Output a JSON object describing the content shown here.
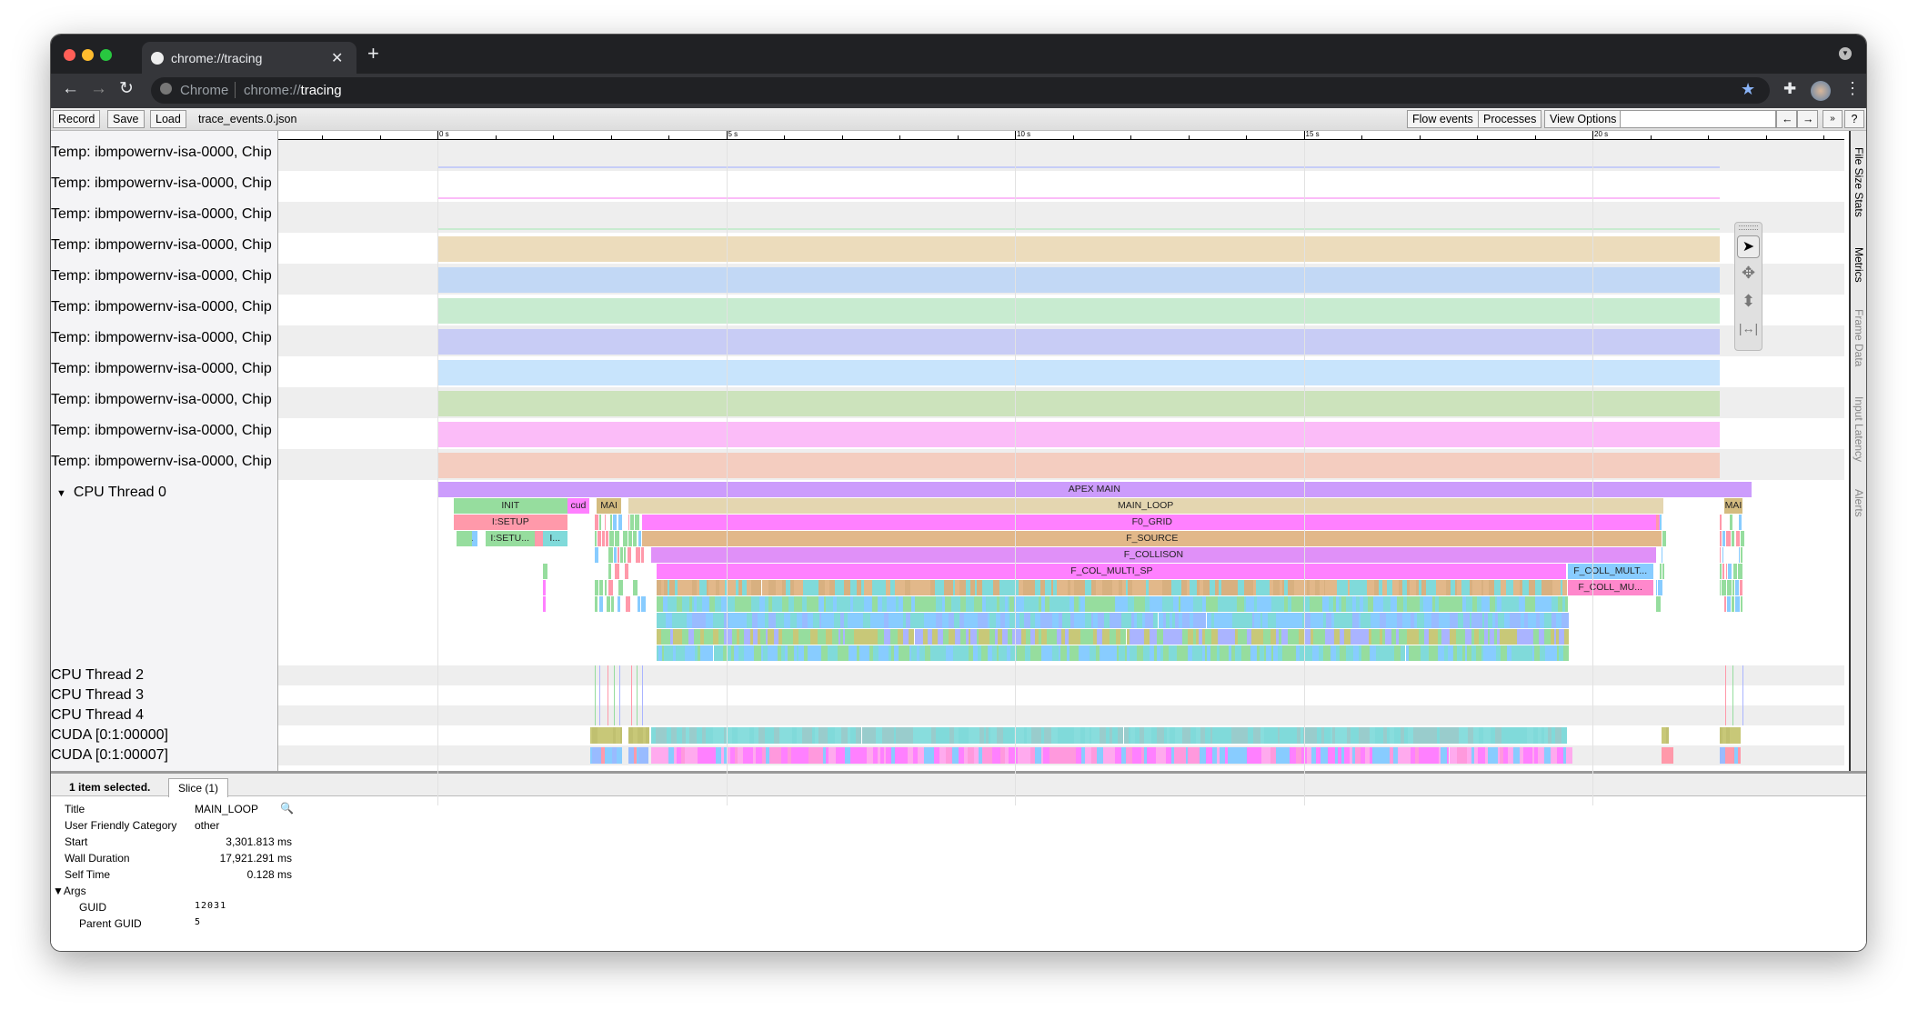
{
  "browser": {
    "tab_title": "chrome://tracing",
    "omnibox_origin": "Chrome",
    "omnibox_url_prefix": "chrome://",
    "omnibox_url_host": "tracing"
  },
  "toolbar": {
    "record": "Record",
    "save": "Save",
    "load": "Load",
    "filename": "trace_events.0.json",
    "flow_events": "Flow events",
    "processes": "Processes",
    "view_options": "View Options",
    "search_placeholder": "",
    "prev": "←",
    "next": "→",
    "collapse": "»",
    "help": "?"
  },
  "ruler": {
    "ticks": [
      {
        "t": 0,
        "label": "0 s"
      },
      {
        "t": 5,
        "label": "5 s"
      },
      {
        "t": 10,
        "label": "10 s"
      },
      {
        "t": 15,
        "label": "15 s"
      },
      {
        "t": 20,
        "label": "20 s"
      }
    ]
  },
  "temp_tracks": [
    {
      "label": "Temp: ibmpowernv-isa-0000, Chip",
      "color": "#c6cdf7",
      "style": "line"
    },
    {
      "label": "Temp: ibmpowernv-isa-0000, Chip",
      "color": "#fbbcf8",
      "style": "line"
    },
    {
      "label": "Temp: ibmpowernv-isa-0000, Chip",
      "color": "#c8ebd0",
      "style": "line"
    },
    {
      "label": "Temp: ibmpowernv-isa-0000, Chip",
      "color": "#ecdcbc",
      "style": "fill"
    },
    {
      "label": "Temp: ibmpowernv-isa-0000, Chip",
      "color": "#c2d8f5",
      "style": "fill"
    },
    {
      "label": "Temp: ibmpowernv-isa-0000, Chip",
      "color": "#c8ebd0",
      "style": "fill"
    },
    {
      "label": "Temp: ibmpowernv-isa-0000, Chip",
      "color": "#c8ccf5",
      "style": "fill"
    },
    {
      "label": "Temp: ibmpowernv-isa-0000, Chip",
      "color": "#c8e4fc",
      "style": "fill"
    },
    {
      "label": "Temp: ibmpowernv-isa-0000, Chip",
      "color": "#cce3bc",
      "style": "fill"
    },
    {
      "label": "Temp: ibmpowernv-isa-0000, Chip",
      "color": "#fbbcf8",
      "style": "fill"
    },
    {
      "label": "Temp: ibmpowernv-isa-0000, Chip",
      "color": "#f4cdc0",
      "style": "fill"
    }
  ],
  "cpu_thread0": {
    "label": "CPU Thread 0",
    "slices": [
      {
        "name": "APEX MAIN",
        "start": 0,
        "end": 22.75,
        "level": 0,
        "color": "#cc9cfc"
      },
      {
        "name": "INIT",
        "start": 0.28,
        "end": 2.25,
        "level": 1,
        "color": "#96dd9e"
      },
      {
        "name": "cud",
        "start": 2.25,
        "end": 2.63,
        "level": 1,
        "color": "#ff80ff"
      },
      {
        "name": "MAI",
        "start": 2.76,
        "end": 3.18,
        "level": 1,
        "color": "#d4bc80"
      },
      {
        "name": "MAIN_LOOP",
        "start": 3.302,
        "end": 21.223,
        "level": 1,
        "color": "#e4d6b0"
      },
      {
        "name": "MAI",
        "start": 22.28,
        "end": 22.6,
        "level": 1,
        "color": "#d4bc80"
      },
      {
        "name": "I:SETUP",
        "start": 0.28,
        "end": 2.25,
        "level": 2,
        "color": "#ff99aa"
      },
      {
        "name": "F0_GRID",
        "start": 3.55,
        "end": 21.2,
        "level": 2,
        "color": "#ff80ff"
      },
      {
        "name": "I...",
        "start": 0.36,
        "end": 0.7,
        "level": 3,
        "color": "#88ccff"
      },
      {
        "name": "I:SETU...",
        "start": 0.83,
        "end": 1.68,
        "level": 3,
        "color": "#96dd9e"
      },
      {
        "name": "",
        "start": 1.68,
        "end": 1.82,
        "level": 3,
        "color": "#ff99aa"
      },
      {
        "name": "I...",
        "start": 1.82,
        "end": 2.25,
        "level": 3,
        "color": "#80dada"
      },
      {
        "name": "F_SOURCE",
        "start": 3.55,
        "end": 21.2,
        "level": 3,
        "color": "#e2b88a"
      },
      {
        "name": "F_COLLISON",
        "start": 3.7,
        "end": 21.1,
        "level": 4,
        "color": "#e090f8"
      },
      {
        "name": "F_COL_MULTI_SP",
        "start": 3.8,
        "end": 19.55,
        "level": 5,
        "color": "#ff80ff"
      },
      {
        "name": "F_COLL_MULT...",
        "start": 19.57,
        "end": 21.05,
        "level": 5,
        "color": "#88ccff"
      },
      {
        "name": "F_COLL_MU...",
        "start": 19.57,
        "end": 21.05,
        "level": 6,
        "color": "#ff88cc"
      }
    ]
  },
  "other_tracks": [
    {
      "label": "CPU Thread 2"
    },
    {
      "label": "CPU Thread 3"
    },
    {
      "label": "CPU Thread 4"
    },
    {
      "label": "CUDA [0:1:00000]"
    },
    {
      "label": "CUDA [0:1:00007]"
    }
  ],
  "side_tabs": [
    "File Size Stats",
    "Metrics",
    "Frame Data",
    "Input Latency",
    "Alerts"
  ],
  "details": {
    "summary": "1 item selected.",
    "tab": "Slice (1)",
    "rows": [
      {
        "k": "Title",
        "v": "MAIN_LOOP"
      },
      {
        "k": "User Friendly Category",
        "v": "other"
      },
      {
        "k": "Start",
        "v": "3,301.813 ms"
      },
      {
        "k": "Wall Duration",
        "v": "17,921.291 ms"
      },
      {
        "k": "Self Time",
        "v": "0.128 ms"
      }
    ],
    "args_label": "Args",
    "args": [
      {
        "k": "GUID",
        "v": "12031"
      },
      {
        "k": "Parent GUID",
        "v": "5"
      }
    ]
  }
}
